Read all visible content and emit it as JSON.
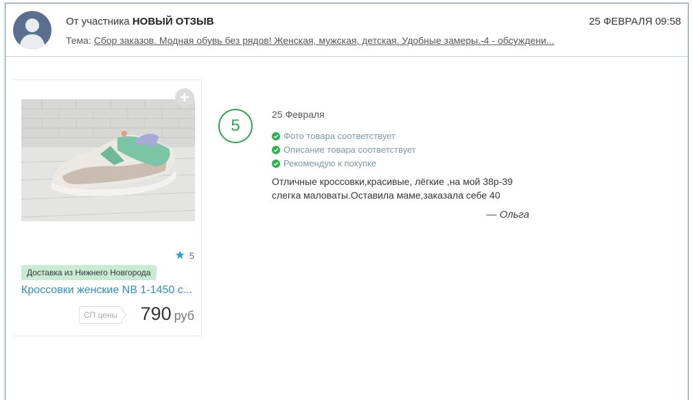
{
  "header": {
    "from_prefix": "От участника",
    "from_title": "НОВЫЙ ОТЗЫВ",
    "datetime": "25 ФЕВРАЛЯ 09:58",
    "topic_label": "Тема:",
    "topic_link": "Сбор заказов. Модная обувь без рядов! Женская, мужская, детская. Удобные замеры.-4 - обсуждени..."
  },
  "product": {
    "rating": "5",
    "delivery": "Доставка из Нижнего Новгорода",
    "name": "Кроссовки женские NB 1-1450 с...",
    "sp_label": "СП цены",
    "price": "790",
    "currency": "руб"
  },
  "review": {
    "score": "5",
    "date": "25 Февраля",
    "checks": [
      "Фото товара соответствует",
      "Описание товара соответствует",
      "Рекомендую к покупке"
    ],
    "text": "Отличные кроссовки,красивые, лёгкие ,на мой 38р-39 слегка маловаты.Оставила маме,заказала себе 40",
    "author": "— Ольга"
  },
  "colors": {
    "accent": "#2a8fc9",
    "frame": "#4a90c4",
    "score": "#27a84a",
    "delivery_bg": "#c8ecd3"
  },
  "icons": {
    "avatar": "user-avatar",
    "add": "plus-icon",
    "star": "star-icon",
    "check": "check-circle-icon"
  }
}
